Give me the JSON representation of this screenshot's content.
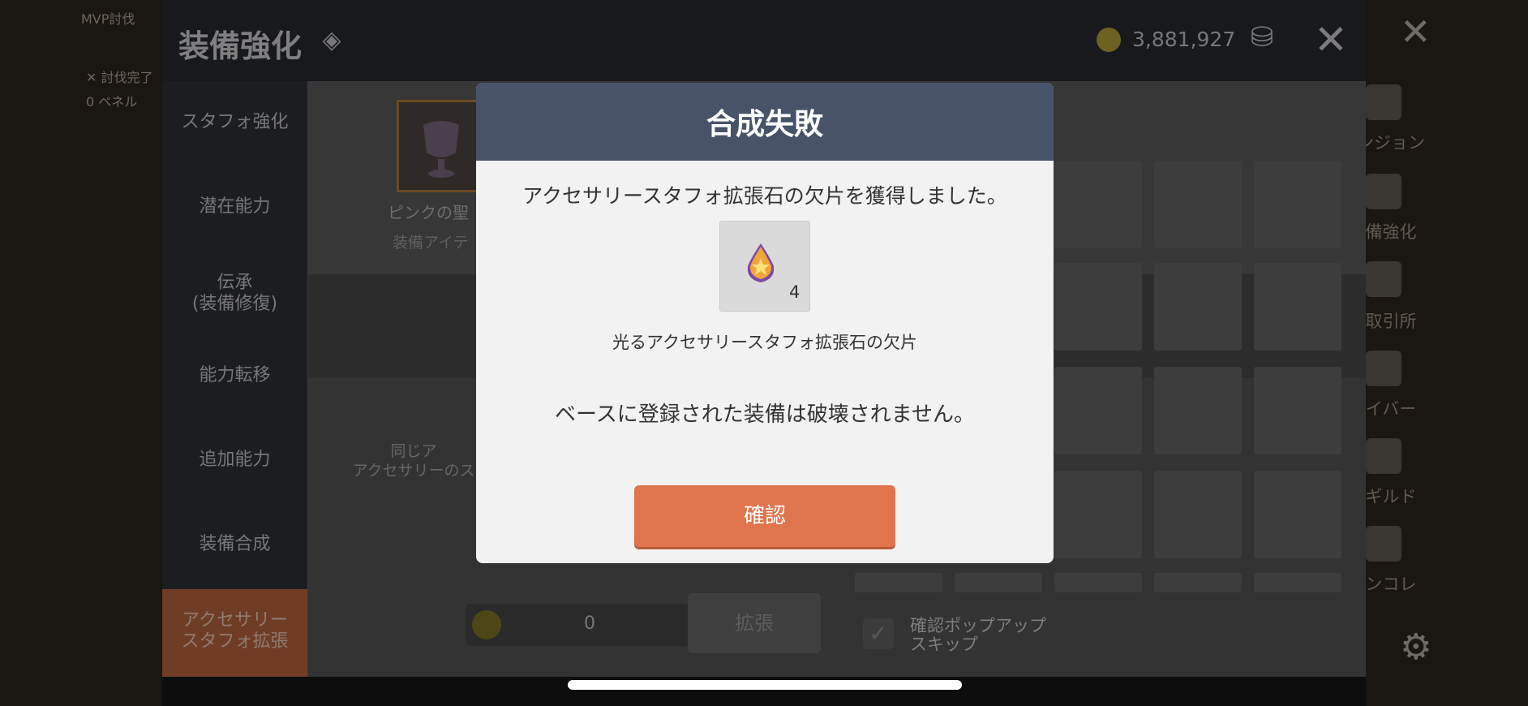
{
  "background": {
    "left_texts": [
      "MVP討伐",
      "✕ 討伐完了",
      "0 ペネル"
    ],
    "right_menu": [
      "ンジョン",
      "備強化",
      "取引所",
      "イバー",
      "ギルド",
      "ンコレ"
    ]
  },
  "header": {
    "title": "装備強化",
    "currency_value": "3,881,927"
  },
  "sidebar": {
    "items": [
      {
        "label": "スタフォ強化"
      },
      {
        "label": "潜在能力"
      },
      {
        "label": "伝承\n(装備修復)"
      },
      {
        "label": "能力転移"
      },
      {
        "label": "追加能力"
      },
      {
        "label": "装備合成"
      },
      {
        "label": "アクセサリー\nスタフォ拡張"
      }
    ]
  },
  "equipment": {
    "name": "ピンクの聖",
    "type": "装備アイテ"
  },
  "description": {
    "line1": "同じア",
    "line2": "アクセサリーのス"
  },
  "cost": {
    "value": "0",
    "button": "拡張"
  },
  "skip": {
    "label": "確認ポップアップ\nスキップ"
  },
  "dialog": {
    "title": "合成失敗",
    "message": "アクセサリースタフォ拡張石の欠片を獲得しました。",
    "item_count": "4",
    "item_name": "光るアクセサリースタフォ拡張石の欠片",
    "note": "ベースに登録された装備は破壊されません。",
    "confirm": "確認"
  },
  "colors": {
    "dialog_header": "#48536a",
    "confirm_button": "#e0744c",
    "active_tab": "#6f3d26"
  }
}
